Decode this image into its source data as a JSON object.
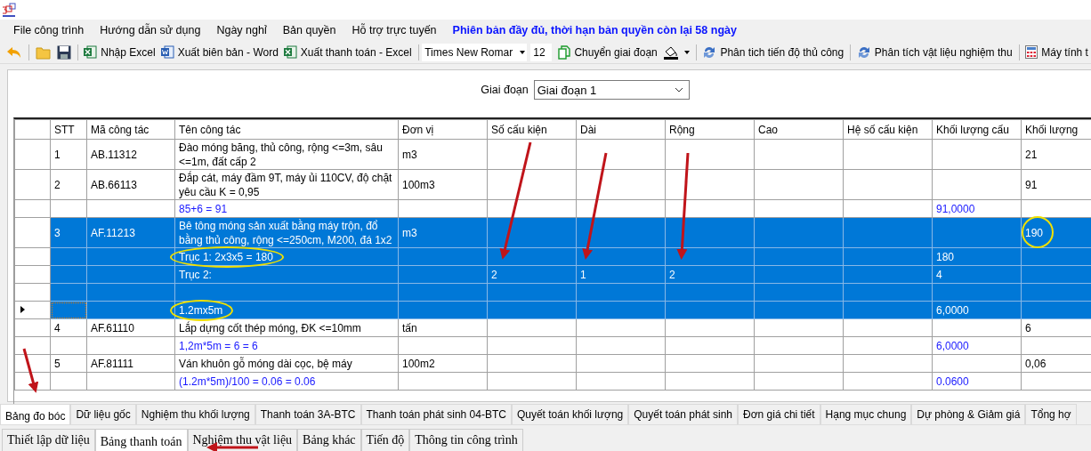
{
  "menu": [
    {
      "label": "File công trình",
      "kind": "menu"
    },
    {
      "label": "Hướng dẫn sử dụng",
      "kind": "menu"
    },
    {
      "label": "Ngày nghỉ",
      "kind": "menu"
    },
    {
      "label": "Bản quyền",
      "kind": "menu"
    },
    {
      "label": "Hỗ trợ trực tuyến",
      "kind": "menu"
    },
    {
      "label": "Phiên bản đầy đủ, thời hạn bản quyền còn lại 58 ngày",
      "kind": "notice"
    }
  ],
  "toolbar": [
    {
      "kind": "back"
    },
    {
      "kind": "separator"
    },
    {
      "kind": "open"
    },
    {
      "kind": "save"
    },
    {
      "kind": "separator"
    },
    {
      "kind": "excel",
      "label": "Nhập Excel"
    },
    {
      "kind": "word",
      "label": "Xuất biên bản - Word"
    },
    {
      "kind": "excel",
      "label": "Xuất thanh toán - Excel"
    },
    {
      "kind": "separator"
    },
    {
      "kind": "font",
      "value": "Times New Romar"
    },
    {
      "kind": "size",
      "value": "12"
    },
    {
      "kind": "copy",
      "label": "Chuyển giai đoạn"
    },
    {
      "kind": "fill"
    },
    {
      "kind": "separator"
    },
    {
      "kind": "refresh",
      "label": "Phân tich tiến độ thủ công"
    },
    {
      "kind": "separator"
    },
    {
      "kind": "refresh",
      "label": "Phân tích vật liệu nghiệm thu"
    },
    {
      "kind": "separator"
    },
    {
      "kind": "calculator",
      "label": "Máy tính t"
    }
  ],
  "stage": {
    "label": "Giai đoạn",
    "value": "Giai đoạn 1"
  },
  "table": {
    "columns": [
      "STT",
      "Mã công tác",
      "Tên công tác",
      "Đơn vị",
      "Số cấu kiện",
      "Dài",
      "Rộng",
      "Cao",
      "Hệ số cấu kiện",
      "Khối lượng cấu",
      "Khối lượng"
    ],
    "rows": [
      {
        "kind": "task",
        "selected": false,
        "current": false,
        "stt": "1",
        "ma_cong_tac": "AB.11312",
        "ten_cong_tac": "Đào móng băng, thủ công, rộng <=3m, sâu <=1m, đất cấp 2",
        "don_vi": "m3",
        "khoi_luong": "21"
      },
      {
        "kind": "task",
        "selected": false,
        "current": false,
        "stt": "2",
        "ma_cong_tac": "AB.66113",
        "ten_cong_tac": "Đắp cát, máy đầm 9T, máy ủi 110CV, độ chặt yêu cầu K = 0,95",
        "don_vi": "100m3",
        "khoi_luong": "91"
      },
      {
        "kind": "formula",
        "selected": false,
        "current": false,
        "ten_cong_tac": "85+6 = 91",
        "khoi_luong_cau": "91,0000"
      },
      {
        "kind": "task",
        "selected": true,
        "current": false,
        "stt": "3",
        "ma_cong_tac": "AF.11213",
        "ten_cong_tac": "Bê tông móng sản xuất bằng máy trộn, đổ bằng thủ công, rộng <=250cm, M200, đá 1x2",
        "don_vi": "m3",
        "khoi_luong": "190"
      },
      {
        "kind": "formula",
        "selected": true,
        "current": false,
        "ten_cong_tac": "Trục 1: 2x3x5 = 180",
        "khoi_luong_cau": "180"
      },
      {
        "kind": "formula",
        "selected": true,
        "current": false,
        "ten_cong_tac": "Trục 2:",
        "so_cau_kien": "2",
        "dai": "1",
        "rong": "2",
        "khoi_luong_cau": "4"
      },
      {
        "kind": "formula",
        "selected": true,
        "current": false
      },
      {
        "kind": "formula",
        "selected": true,
        "current": true,
        "ten_cong_tac": "1.2mx5m",
        "khoi_luong_cau": "6,0000"
      },
      {
        "kind": "task",
        "selected": false,
        "current": false,
        "stt": "4",
        "ma_cong_tac": "AF.61110",
        "ten_cong_tac": "Lắp dựng cốt thép móng, ĐK <=10mm",
        "don_vi": "tấn",
        "khoi_luong": "6"
      },
      {
        "kind": "formula",
        "selected": false,
        "current": false,
        "ten_cong_tac": "1,2m*5m = 6 = 6",
        "khoi_luong_cau": "6,0000"
      },
      {
        "kind": "task",
        "selected": false,
        "current": false,
        "stt": "5",
        "ma_cong_tac": "AF.81111",
        "ten_cong_tac": "Ván khuôn gỗ móng dài cọc, bệ máy",
        "don_vi": "100m2",
        "khoi_luong": "0,06"
      },
      {
        "kind": "formula",
        "selected": false,
        "current": false,
        "ten_cong_tac": "(1.2m*5m)/100 = 0.06 = 0.06",
        "khoi_luong_cau": "0.0600"
      }
    ]
  },
  "sheet_tabs": [
    {
      "label": "Bảng đo bóc",
      "selected": true
    },
    {
      "label": "Dữ liệu gốc",
      "selected": false
    },
    {
      "label": "Nghiệm thu khối lượng",
      "selected": false
    },
    {
      "label": "Thanh toán 3A-BTC",
      "selected": false
    },
    {
      "label": "Thanh toán phát sinh 04-BTC",
      "selected": false
    },
    {
      "label": "Quyết toán khối lượng",
      "selected": false
    },
    {
      "label": "Quyết toán phát sinh",
      "selected": false
    },
    {
      "label": "Đơn giá chi tiết",
      "selected": false
    },
    {
      "label": "Hạng mục chung",
      "selected": false
    },
    {
      "label": "Dự phòng & Giảm giá",
      "selected": false
    },
    {
      "label": "Tổng hợ",
      "selected": false
    }
  ],
  "main_tabs": [
    {
      "label": "Thiết lập dữ liệu",
      "selected": false
    },
    {
      "label": "Bảng thanh toán",
      "selected": true
    },
    {
      "label": "Nghiệm thu vật liệu",
      "selected": false
    },
    {
      "label": "Bảng khác",
      "selected": false
    },
    {
      "label": "Tiến độ",
      "selected": false
    },
    {
      "label": "Thông tin công trình",
      "selected": false
    }
  ]
}
